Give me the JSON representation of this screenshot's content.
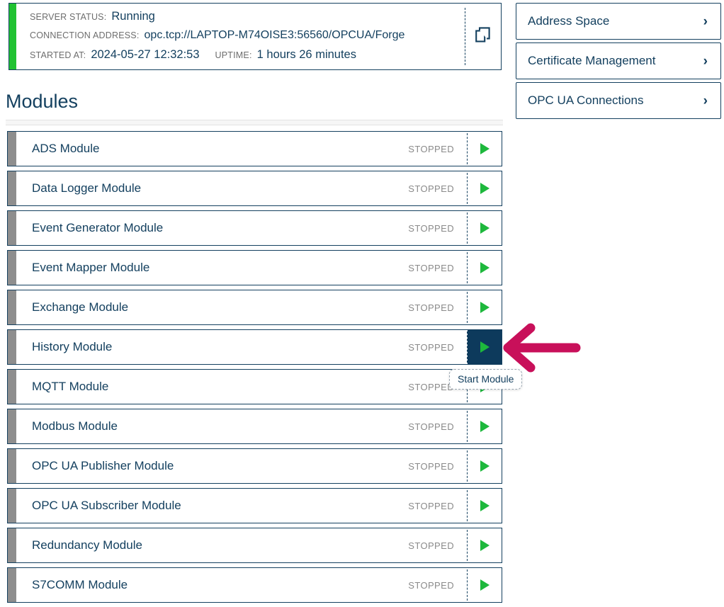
{
  "status_panel": {
    "accent_color": "#21c232",
    "rows": [
      {
        "key": "SERVER STATUS:",
        "value": "Running"
      },
      {
        "key": "CONNECTION ADDRESS:",
        "value": "opc.tcp://LAPTOP-M74OISE3:56560/OPCUA/Forge"
      }
    ],
    "started_key": "STARTED AT:",
    "started_value": "2024-05-27 12:32:53",
    "uptime_key": "UPTIME:",
    "uptime_value": "1 hours 26 minutes",
    "copy_icon": "copy-icon"
  },
  "modules_section": {
    "heading": "Modules",
    "state_label": "STOPPED",
    "play_icon": "play-icon",
    "accent_color": "#8e8e8e",
    "play_color": "#1db83c",
    "hover_bg": "#0d3a5c",
    "items": [
      {
        "name": "ADS Module",
        "state": "STOPPED",
        "hovered": false
      },
      {
        "name": "Data Logger Module",
        "state": "STOPPED",
        "hovered": false
      },
      {
        "name": "Event Generator Module",
        "state": "STOPPED",
        "hovered": false
      },
      {
        "name": "Event Mapper Module",
        "state": "STOPPED",
        "hovered": false
      },
      {
        "name": "Exchange Module",
        "state": "STOPPED",
        "hovered": false
      },
      {
        "name": "History Module",
        "state": "STOPPED",
        "hovered": true
      },
      {
        "name": "MQTT Module",
        "state": "STOPPED",
        "hovered": false
      },
      {
        "name": "Modbus Module",
        "state": "STOPPED",
        "hovered": false
      },
      {
        "name": "OPC UA Publisher Module",
        "state": "STOPPED",
        "hovered": false
      },
      {
        "name": "OPC UA Subscriber Module",
        "state": "STOPPED",
        "hovered": false
      },
      {
        "name": "Redundancy Module",
        "state": "STOPPED",
        "hovered": false
      },
      {
        "name": "S7COMM Module",
        "state": "STOPPED",
        "hovered": false
      }
    ]
  },
  "tooltip": {
    "text": "Start Module"
  },
  "annotation_arrow": {
    "color": "#c8105a",
    "direction": "left",
    "points_to": "History Module start button"
  },
  "sidebar": {
    "buttons": [
      {
        "label": "Address Space",
        "chevron": "›"
      },
      {
        "label": "Certificate Management",
        "chevron": "›"
      },
      {
        "label": "OPC UA Connections",
        "chevron": "›"
      }
    ]
  }
}
